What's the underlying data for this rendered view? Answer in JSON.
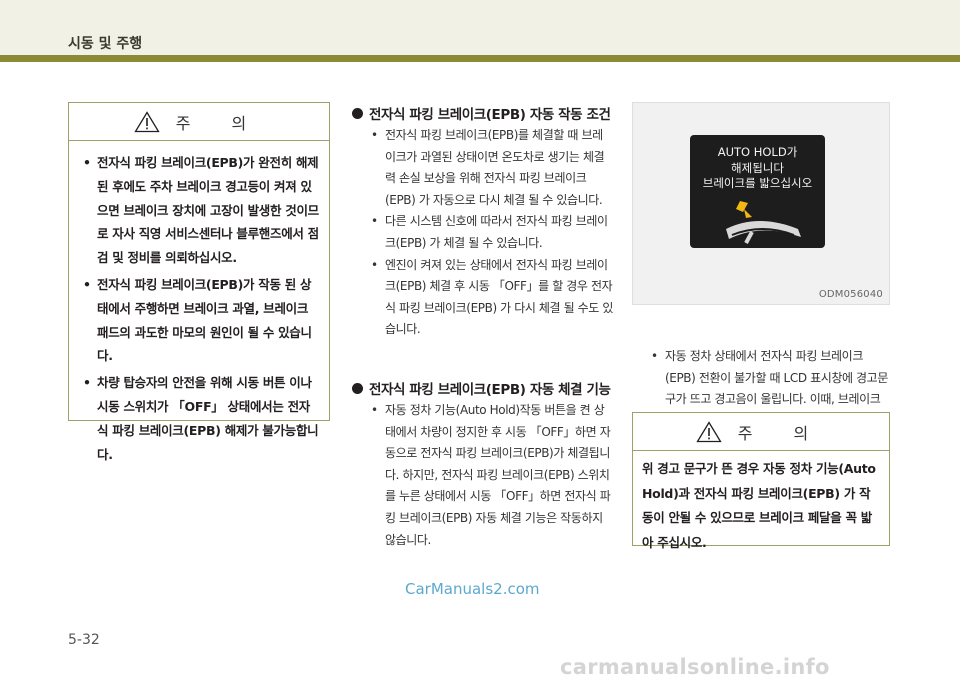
{
  "header": {
    "chapter_title": "시동 및 주행"
  },
  "caution_left": {
    "label": "주 의",
    "items": [
      "전자식 파킹 브레이크(EPB)가 완전히 해제된 후에도 주차 브레이크 경고등이 켜져 있으면 브레이크 장치에 고장이 발생한 것이므로 자사 직영 서비스센터나 블루핸즈에서 점검 및 정비를 의뢰하십시오.",
      "전자식 파킹 브레이크(EPB)가 작동 된 상태에서 주행하면 브레이크 과열, 브레이크 패드의 과도한 마모의 원인이 될 수 있습니다.",
      "차량 탑승자의 안전을 위해 시동 버튼 이나 시동 스위치가 「OFF」 상태에서는 전자식 파킹 브레이크(EPB) 해제가 불가능합니다."
    ]
  },
  "section_auto_apply": {
    "title": "전자식 파킹 브레이크(EPB) 자동 작동 조건",
    "items": [
      "전자식 파킹 브레이크(EPB)를 체결할 때 브레이크가 과열된 상태이면 온도차로 생기는 체결력 손실 보상을 위해 전자식 파킹 브레이크(EPB) 가 자동으로 다시 체결 될 수 있습니다.",
      "다른 시스템 신호에 따라서 전자식 파킹 브레이크(EPB) 가 체결 될 수 있습니다.",
      "엔진이 켜져 있는 상태에서 전자식 파킹 브레이크(EPB) 체결 후 시동 「OFF」를 할 경우 전자식 파킹 브레이크(EPB) 가 다시 체결 될 수도 있습니다."
    ]
  },
  "section_auto_release": {
    "title": "전자식 파킹 브레이크(EPB) 자동 체결 기능",
    "items": [
      "자동 정차 기능(Auto Hold)작동 버튼을 켠 상태에서 차량이 정지한 후 시동 「OFF」하면 자동으로 전자식 파킹 브레이크(EPB)가 체결됩니다. 하지만, 전자식 파킹 브레이크(EPB) 스위치를 누른 상태에서 시동 「OFF」하면 전자식 파킹 브레이크(EPB) 자동 체결 기능은 작동하지 않습니다."
    ]
  },
  "figure": {
    "screen_lines": [
      "AUTO HOLD가",
      "해제됩니다",
      "브레이크를 밟으십시오"
    ],
    "code": "ODM056040"
  },
  "right_note": {
    "items": [
      "자동 정차 상태에서 전자식 파킹 브레이크(EPB) 전환이 불가할 때 LCD 표시창에 경고문구가 뜨고 경고음이 울립니다. 이때, 브레이크 페달을 밟으십시오."
    ]
  },
  "caution_right": {
    "label": "주 의",
    "text": "위 경고 문구가 뜬 경우 자동 정차 기능(Auto Hold)과 전자식 파킹 브레이크(EPB) 가 작동이 안될 수 있으므로 브레이크 페달을 꼭 밟아 주십시오."
  },
  "footer": {
    "watermark": "CarManuals2.com",
    "page_number": "5-32",
    "bottom_watermark": "carmanualsonline.info"
  }
}
